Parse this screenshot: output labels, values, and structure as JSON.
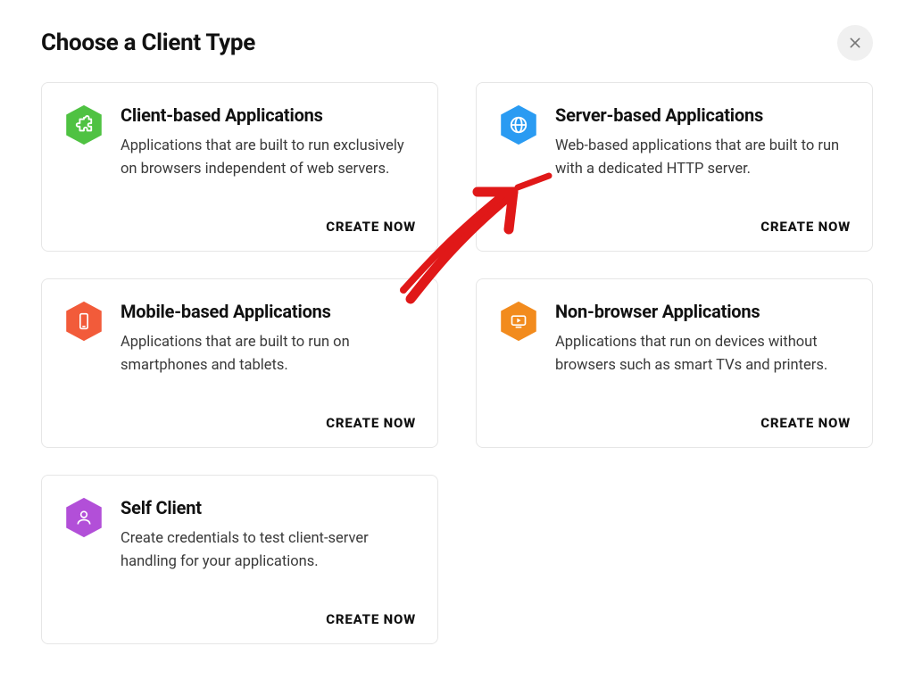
{
  "header": {
    "title": "Choose a Client Type"
  },
  "cards": [
    {
      "title": "Client-based Applications",
      "description": "Applications that are built to run exclusively on browsers independent of web servers.",
      "create_label": "CREATE NOW",
      "icon": "puzzle-icon",
      "color": "#4fc242"
    },
    {
      "title": "Server-based Applications",
      "description": "Web-based applications that are built to run with a dedicated HTTP server.",
      "create_label": "CREATE NOW",
      "icon": "globe-icon",
      "color": "#2a9bf2"
    },
    {
      "title": "Mobile-based Applications",
      "description": "Applications that are built to run on smartphones and tablets.",
      "create_label": "CREATE NOW",
      "icon": "mobile-icon",
      "color": "#f25b3a"
    },
    {
      "title": "Non-browser Applications",
      "description": "Applications that run on devices without browsers such as smart TVs and printers.",
      "create_label": "CREATE NOW",
      "icon": "tv-icon",
      "color": "#f28b1d"
    },
    {
      "title": "Self Client",
      "description": "Create credentials to test client-server handling for your applications.",
      "create_label": "CREATE NOW",
      "icon": "person-icon",
      "color": "#b24fd8"
    }
  ],
  "annotation": {
    "type": "arrow",
    "color": "#e01818",
    "target": "server-based-applications"
  }
}
